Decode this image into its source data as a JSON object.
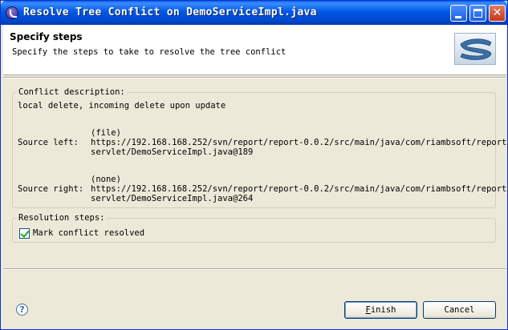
{
  "window": {
    "title": "Resolve Tree Conflict on DemoServiceImpl.java",
    "controls": {
      "minimize": "minimize-icon",
      "maximize": "maximize-icon",
      "close": "close-icon"
    }
  },
  "header": {
    "title": "Specify steps",
    "description": "Specify the steps to take to resolve the tree conflict",
    "logo": "subversive-logo-icon"
  },
  "conflict": {
    "legend": "Conflict description:",
    "summary": "local delete, incoming delete upon update",
    "source_left": {
      "label": "Source left:",
      "kind": "(file)",
      "url_line1": "https://192.168.168.252/svn/report/report-0.0.2/src/main/java/com/riambsoft/report/",
      "url_line2": "servlet/DemoServiceImpl.java@189"
    },
    "source_right": {
      "label": "Source right:",
      "kind": "(none)",
      "url_line1": "https://192.168.168.252/svn/report/report-0.0.2/src/main/java/com/riambsoft/report/",
      "url_line2": "servlet/DemoServiceImpl.java@264"
    }
  },
  "resolution": {
    "legend": "Resolution steps:",
    "mark_resolved_label": "Mark conflict resolved",
    "mark_resolved_checked": true
  },
  "footer": {
    "help_icon": "help-icon",
    "finish_label_first": "F",
    "finish_label_rest": "inish",
    "cancel_label": "Cancel"
  }
}
